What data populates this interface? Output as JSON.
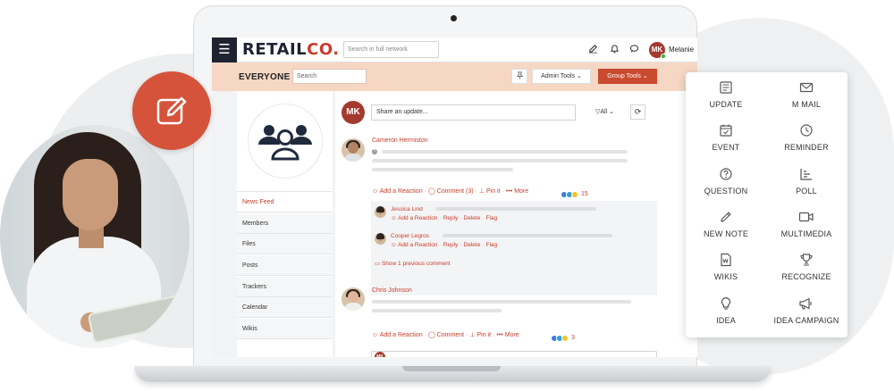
{
  "app": {
    "brand_main": "RETAIL",
    "brand_suffix": "CO.",
    "network_search_placeholder": "Search in full network",
    "user_initials": "MK",
    "user_name": "Melanie"
  },
  "group": {
    "title": "EVERYONE",
    "search_placeholder": "Search",
    "admin_tools": "Admin Tools",
    "group_tools": "Group Tools"
  },
  "sidebar": {
    "items": [
      {
        "label": "News Feed",
        "active": true
      },
      {
        "label": "Members"
      },
      {
        "label": "Files"
      },
      {
        "label": "Posts"
      },
      {
        "label": "Trackers"
      },
      {
        "label": "Calendar"
      },
      {
        "label": "Wikis"
      }
    ]
  },
  "feed": {
    "share_placeholder": "Share an update...",
    "filter_label": "All",
    "posts": [
      {
        "author": "Cameron Hermiston",
        "actions": {
          "reaction": "Add a Reaction",
          "comment": "Comment (3)",
          "pin": "Pin it",
          "more": "More"
        },
        "reaction_count": "15",
        "comments": [
          {
            "author": "Jessica Lind",
            "actions": {
              "reaction": "Add a Reaction",
              "reply": "Reply",
              "delete": "Delete",
              "flag": "Flag"
            }
          },
          {
            "author": "Cooper Legros",
            "actions": {
              "reaction": "Add a Reaction",
              "reply": "Reply",
              "delete": "Delete",
              "flag": "Flag"
            }
          }
        ],
        "show_previous": "Show 1 previous comment"
      },
      {
        "author": "Chris Johnson",
        "actions": {
          "reaction": "Add a Reaction",
          "comment": "Comment",
          "pin": "Pin it",
          "more": "More"
        },
        "reaction_count": "3"
      }
    ]
  },
  "menu": {
    "items": [
      {
        "label": "UPDATE",
        "icon": "update-icon"
      },
      {
        "label": "M MAIL",
        "icon": "mail-icon"
      },
      {
        "label": "EVENT",
        "icon": "calendar-icon"
      },
      {
        "label": "REMINDER",
        "icon": "clock-icon"
      },
      {
        "label": "QUESTION",
        "icon": "question-icon"
      },
      {
        "label": "POLL",
        "icon": "poll-icon"
      },
      {
        "label": "NEW NOTE",
        "icon": "pencil-icon"
      },
      {
        "label": "MULTIMEDIA",
        "icon": "video-icon"
      },
      {
        "label": "WIKIS",
        "icon": "wiki-icon"
      },
      {
        "label": "RECOGNIZE",
        "icon": "trophy-icon"
      },
      {
        "label": "IDEA",
        "icon": "lightbulb-icon"
      },
      {
        "label": "IDEA CAMPAIGN",
        "icon": "megaphone-icon"
      }
    ]
  },
  "colors": {
    "accent": "#c73d2b",
    "header_band": "#f6d7c4",
    "dark": "#1f2330",
    "edit_circle": "#d5533a"
  }
}
